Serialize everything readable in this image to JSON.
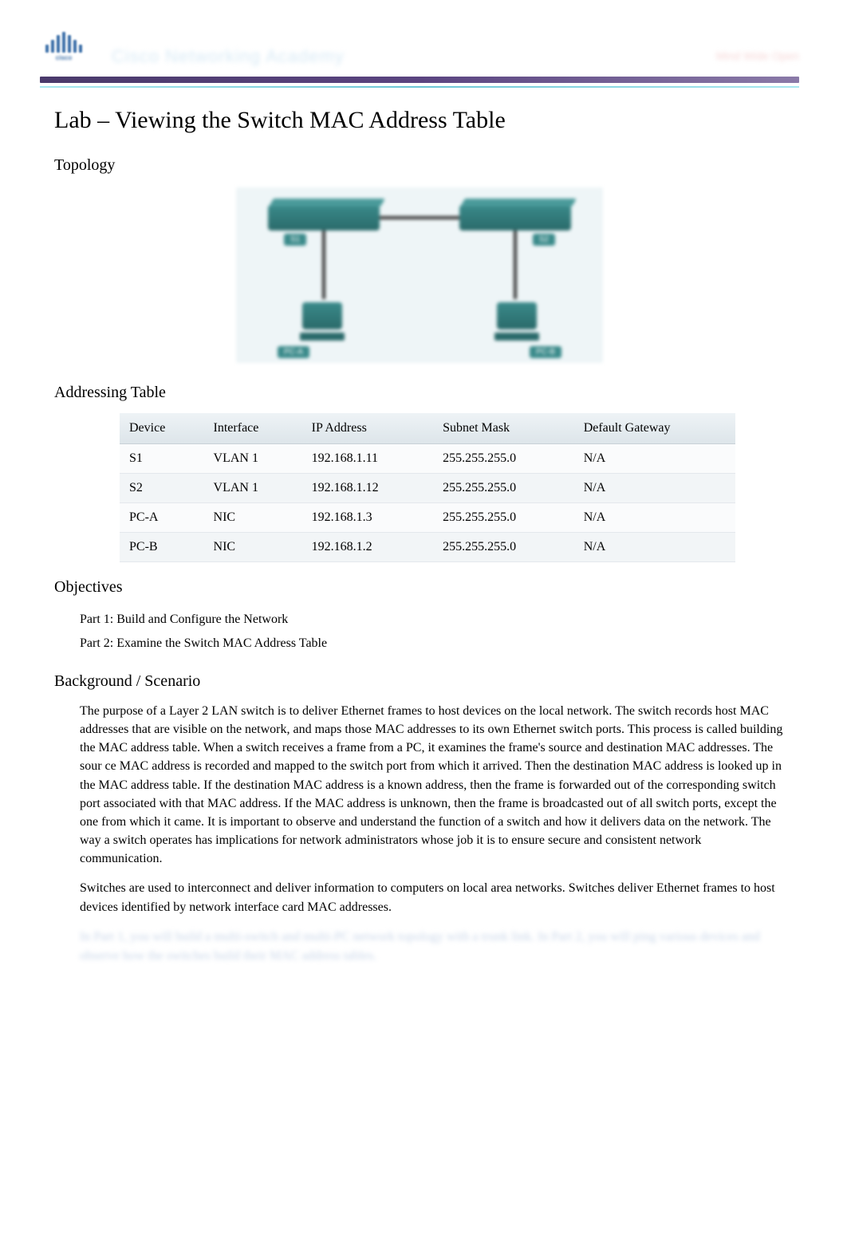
{
  "header": {
    "logo_text": "cisco",
    "brand": "Cisco Networking Academy",
    "tagline": "Mind Wide Open"
  },
  "title": "Lab  – Viewing the Switch MAC Address Table",
  "sections": {
    "topology": "Topology",
    "addressing": "Addressing Table",
    "objectives": "Objectives",
    "background": "Background / Scenario"
  },
  "topology_labels": {
    "s1": "S1",
    "s2": "S2",
    "pca": "PC-A",
    "pcb": "PC-B"
  },
  "addressing_table": {
    "headers": [
      "Device",
      "Interface",
      "IP Address",
      "Subnet Mask",
      "Default Gateway"
    ],
    "rows": [
      [
        "S1",
        "VLAN 1",
        "192.168.1.11",
        "255.255.255.0",
        "N/A"
      ],
      [
        "S2",
        "VLAN 1",
        "192.168.1.12",
        "255.255.255.0",
        "N/A"
      ],
      [
        "PC-A",
        "NIC",
        "192.168.1.3",
        "255.255.255.0",
        "N/A"
      ],
      [
        "PC-B",
        "NIC",
        "192.168.1.2",
        "255.255.255.0",
        "N/A"
      ]
    ]
  },
  "objectives": [
    "Part 1: Build and Configure the Network",
    "Part 2: Examine the Switch MAC Address Table"
  ],
  "background_paragraphs": [
    "The purpose of a Layer 2 LAN switch is to deliver Ethernet frames to host devices on the local network. The switch records host MAC addresses that are visible on the network, and maps those MAC addresses to its own Ethernet switch ports. This process is called building the MAC address table. When a switch receives a frame  from a PC, it examines the frame's source and destination MAC addresses. The sour              ce MAC address is recorded and mapped to the switch port from which it arrived. Then the destination MAC address is looked up in the MAC address table. If the destination MAC address is a known address, then the frame is forwarded out of the corresponding switch port associated with that MAC address. If the MAC address is unknown, then the frame is broadcasted out of all switch ports, except the one from which it came. It is important to observe and understand the function of a switch and how it delivers data on the network. The way a switch operates has implications for network administrators whose job it is to ensure secure and consistent network communication.",
    "Switches are used to interconnect and deliver information to computers on local area networks. Switches deliver Ethernet frames to host devices identified by network interface card MAC addresses."
  ],
  "blurred_text": "In Part 1, you will build a multi-switch and multi-PC network topology with a trunk link. In Part 2, you will ping various devices and observe how the switches build their MAC address tables."
}
